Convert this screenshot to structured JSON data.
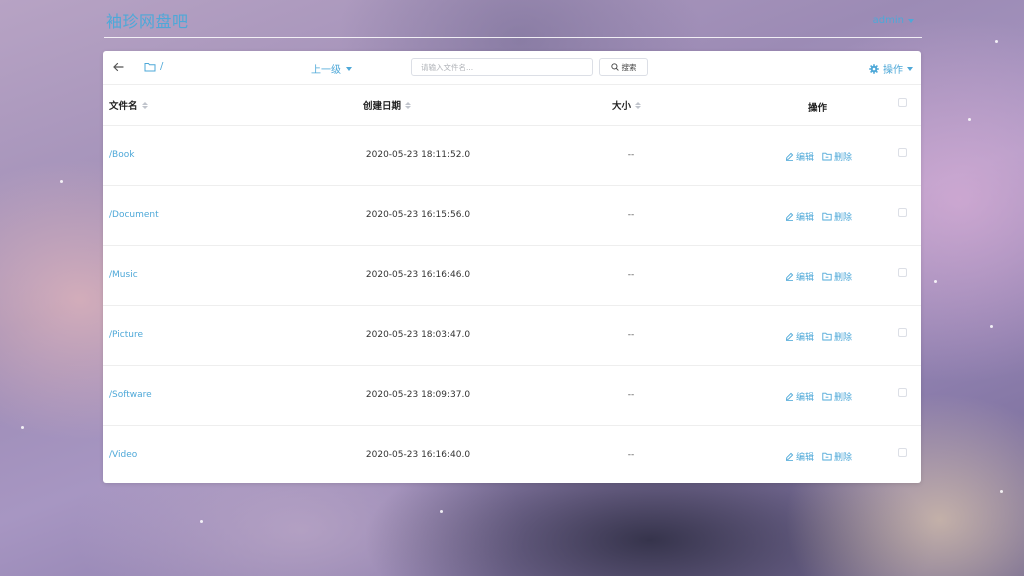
{
  "app": {
    "brand": "袖珍网盘吧",
    "user": "admin"
  },
  "toolbar": {
    "path": "/",
    "up_label": "上一级",
    "search_placeholder": "请输入文件名...",
    "search_label": "搜索",
    "ops_label": "操作"
  },
  "table": {
    "headers": {
      "name": "文件名",
      "created": "创建日期",
      "size": "大小",
      "actions": "操作"
    },
    "edit_label": "编辑",
    "delete_label": "删除",
    "rows": [
      {
        "name": "/Book",
        "created": "2020-05-23 18:11:52.0",
        "size": "--"
      },
      {
        "name": "/Document",
        "created": "2020-05-23 16:15:56.0",
        "size": "--"
      },
      {
        "name": "/Music",
        "created": "2020-05-23 16:16:46.0",
        "size": "--"
      },
      {
        "name": "/Picture",
        "created": "2020-05-23 18:03:47.0",
        "size": "--"
      },
      {
        "name": "/Software",
        "created": "2020-05-23 18:09:37.0",
        "size": "--"
      },
      {
        "name": "/Video",
        "created": "2020-05-23 16:16:40.0",
        "size": "--"
      }
    ]
  },
  "colors": {
    "accent": "#4ea8d8",
    "border": "#eeeeee"
  }
}
